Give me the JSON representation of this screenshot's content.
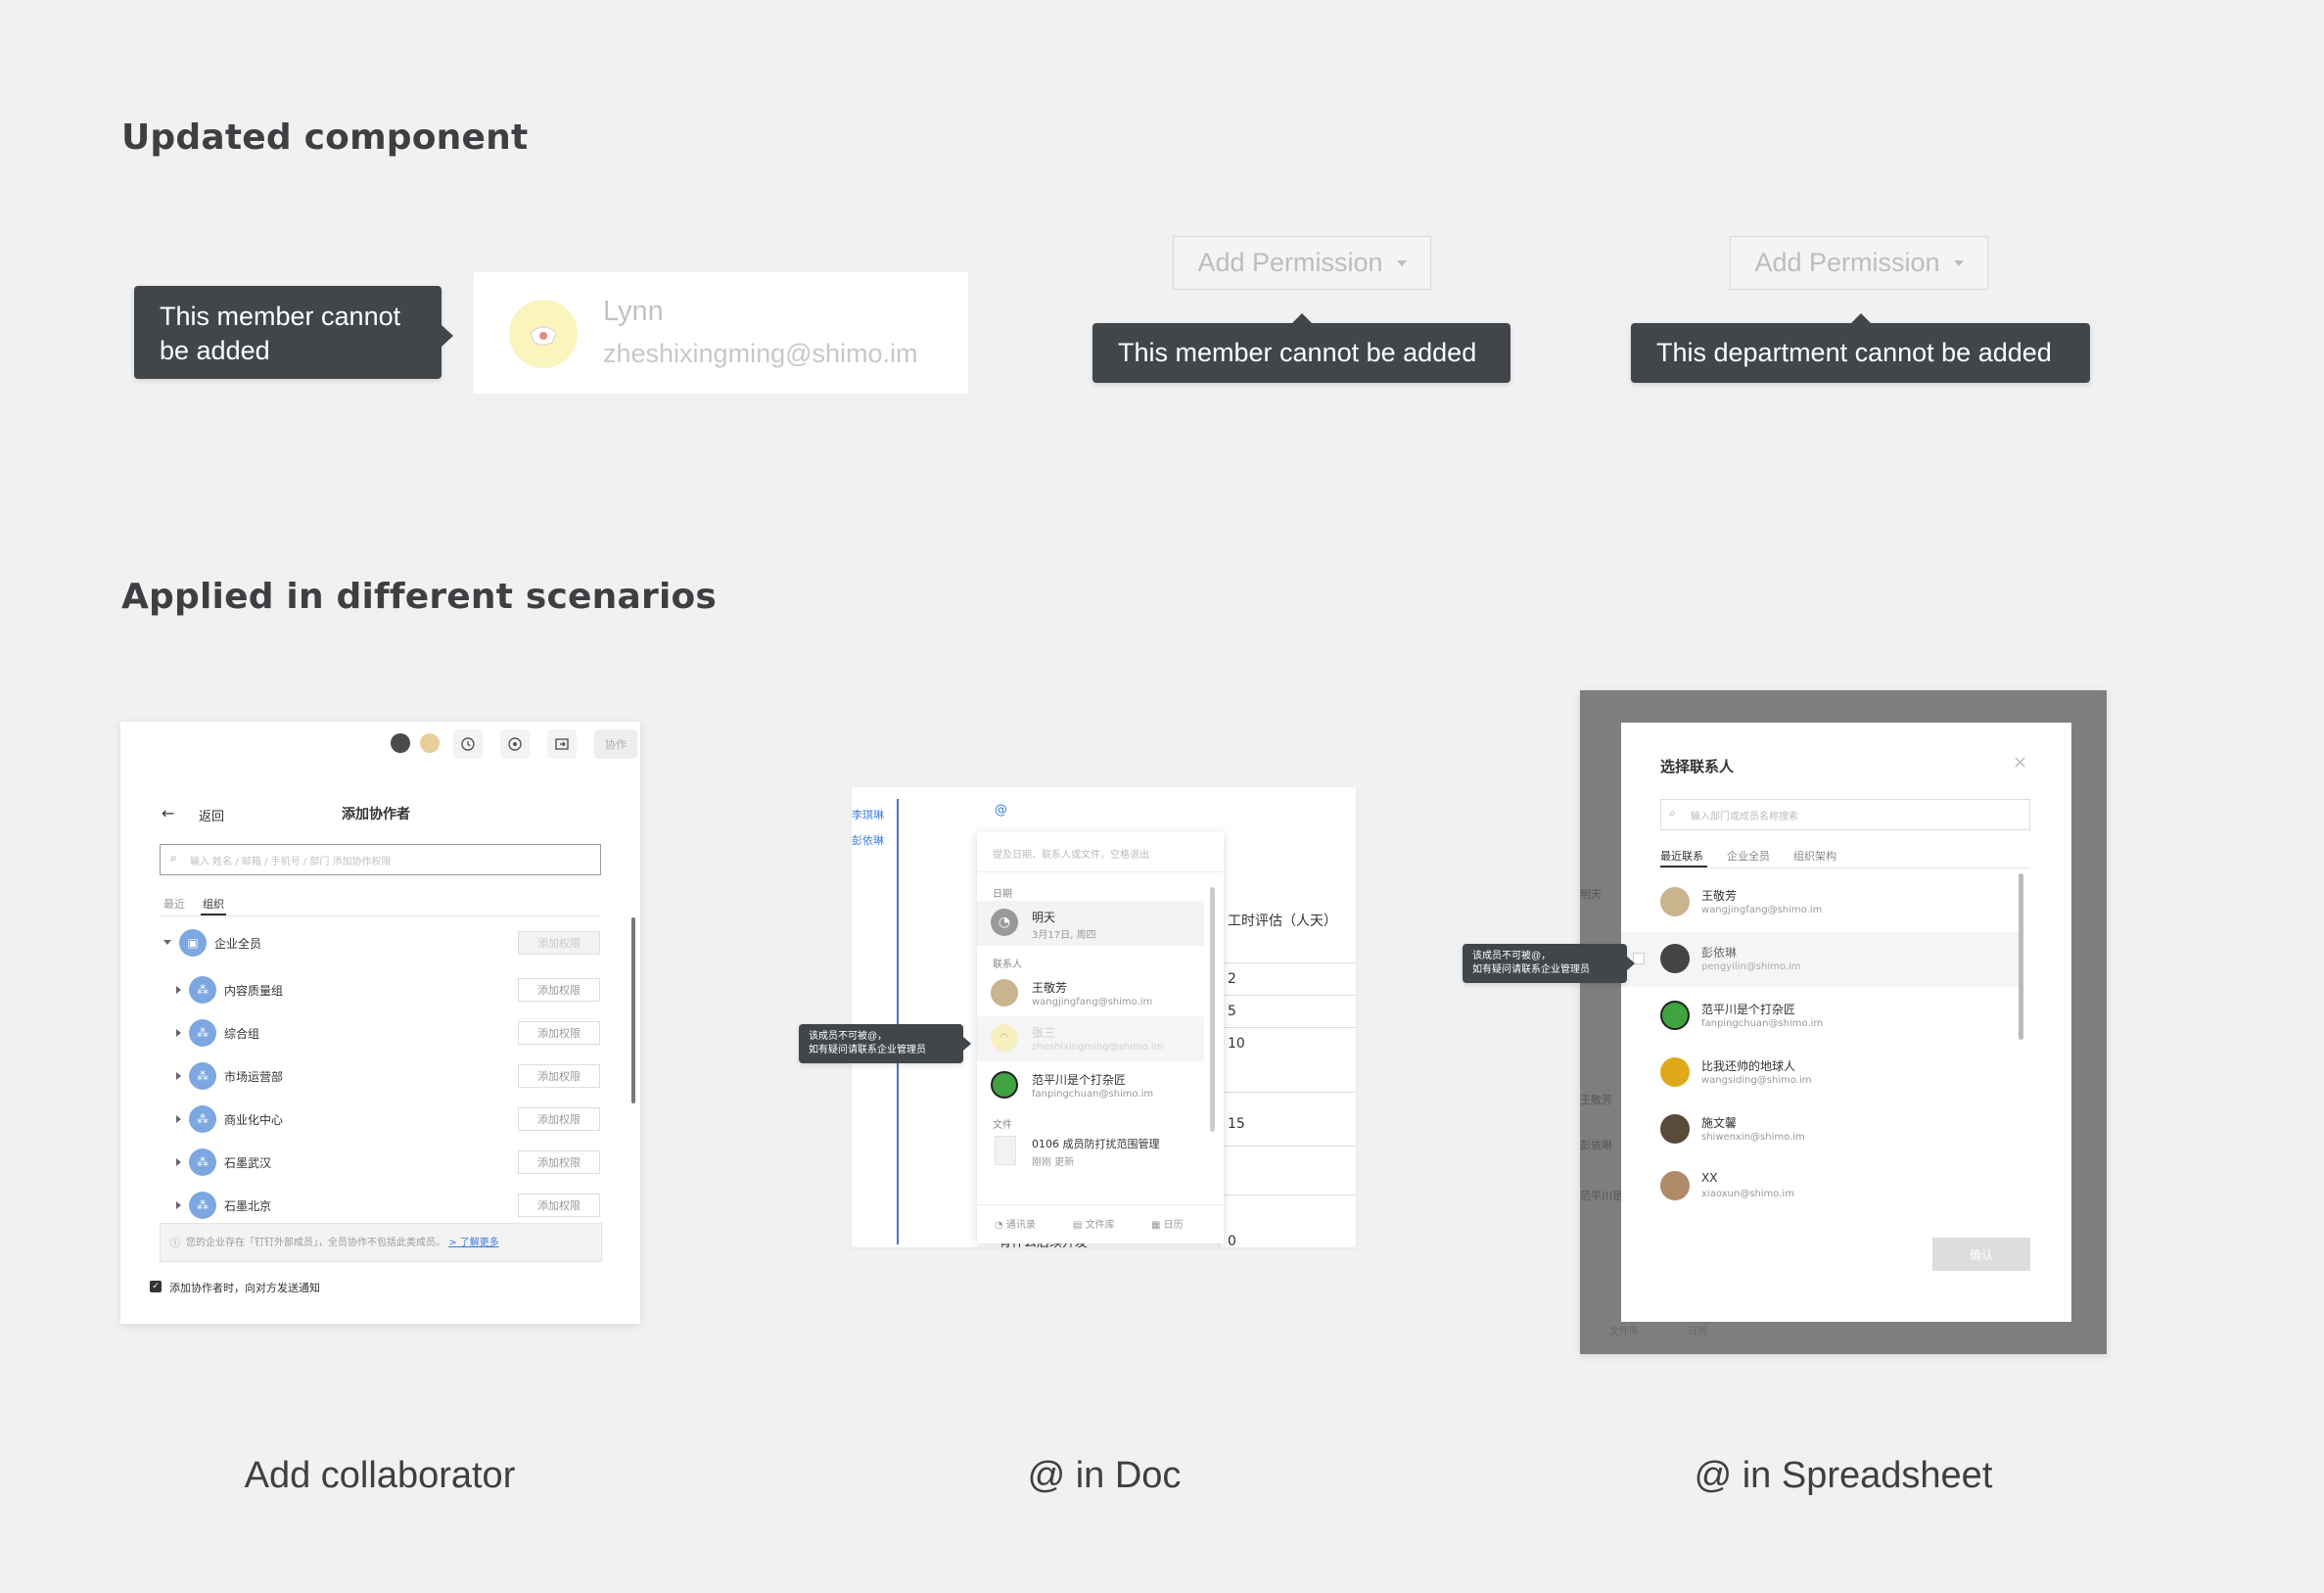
{
  "sections": {
    "updated_title": "Updated component",
    "applied_title": "Applied in different scenarios"
  },
  "component_demo": {
    "tooltip_left_line1": "This member cannot",
    "tooltip_left_line2": "be added",
    "member_name": "Lynn",
    "member_email": "zheshixingming@shimo.im",
    "add_permission_1": "Add Permission",
    "tooltip_member": "This member cannot be added",
    "add_permission_2": "Add Permission",
    "tooltip_department": "This department cannot be added"
  },
  "captions": {
    "add_collaborator": "Add collaborator",
    "at_in_doc": "@ in Doc",
    "at_in_spreadsheet": "@ in Spreadsheet"
  },
  "add_collab": {
    "toolbar_collab": "协作",
    "back": "返回",
    "title": "添加协作者",
    "search_placeholder": "输入 姓名 / 邮箱 / 手机号 / 部门 添加协作权限",
    "tab_recent": "最近",
    "tab_org": "组织",
    "root": "企业全员",
    "root_btn": "添加权限",
    "depts": [
      {
        "name": "内容质量组",
        "btn": "添加权限"
      },
      {
        "name": "综合组",
        "btn": "添加权限"
      },
      {
        "name": "市场运营部",
        "btn": "添加权限"
      },
      {
        "name": "商业化中心",
        "btn": "添加权限"
      },
      {
        "name": "石墨武汉",
        "btn": "添加权限"
      },
      {
        "name": "石墨北京",
        "btn": "添加权限"
      }
    ],
    "notice": "您的企业存在「钉钉外部成员」，全员协作不包括此类成员。",
    "notice_link": "> 了解更多",
    "notify_label": "添加协作者时，向对方发送通知"
  },
  "doc": {
    "side_names": [
      "李琪琳",
      "彭依琳"
    ],
    "at_char": "@",
    "search_hint": "提及日期、联系人或文件，空格退出",
    "sec_date": "日期",
    "date_item": "明天",
    "date_sub": "3月17日, 周四",
    "sec_contacts": "联系人",
    "contacts": [
      {
        "name": "王敬芳",
        "email": "wangjingfang@shimo.im"
      },
      {
        "name": "张三",
        "email": "zheshixingming@shimo.im"
      },
      {
        "name": "范平川是个打杂匠",
        "email": "fanpingchuan@shimo.im"
      }
    ],
    "sec_files": "文件",
    "file_name": "0106 成员防打扰范围管理",
    "file_sub": "刚刚 更新",
    "footer": [
      "通讯录",
      "文件库",
      "日历"
    ],
    "table_header": "工时评估（人天）",
    "table_values": [
      "2",
      "5",
      "10",
      "15",
      "0"
    ],
    "bottom_text": "有什么后续开发",
    "tooltip_line1": "该成员不可被@，",
    "tooltip_line2": "如有疑问请联系企业管理员"
  },
  "sheet": {
    "title": "选择联系人",
    "search_placeholder": "输入部门或成员名称搜索",
    "tabs": [
      "最近联系",
      "企业全员",
      "组织架构"
    ],
    "contacts": [
      {
        "name": "王敬芳",
        "email": "wangjingfang@shimo.im"
      },
      {
        "name": "彭依琳",
        "email": "pengyilin@shimo.im"
      },
      {
        "name": "范平川是个打杂匠",
        "email": "fanpingchuan@shimo.im"
      },
      {
        "name": "比我还帅的地球人",
        "email": "wangsiding@shimo.im"
      },
      {
        "name": "施文馨",
        "email": "shiwenxin@shimo.im"
      },
      {
        "name": "XX",
        "email": "xiaoxun@shimo.im"
      }
    ],
    "confirm": "确认",
    "tooltip_line1": "该成员不可被@，",
    "tooltip_line2": "如有疑问请联系企业管理员",
    "bg_names": [
      "王敬芳",
      "彭依琳",
      "范平川是",
      "明天"
    ],
    "bg_footer": [
      "文件库",
      "日历"
    ]
  },
  "colors": {
    "background": "#f1f1f1",
    "tooltip": "#41464b",
    "link": "#3a7be0"
  }
}
